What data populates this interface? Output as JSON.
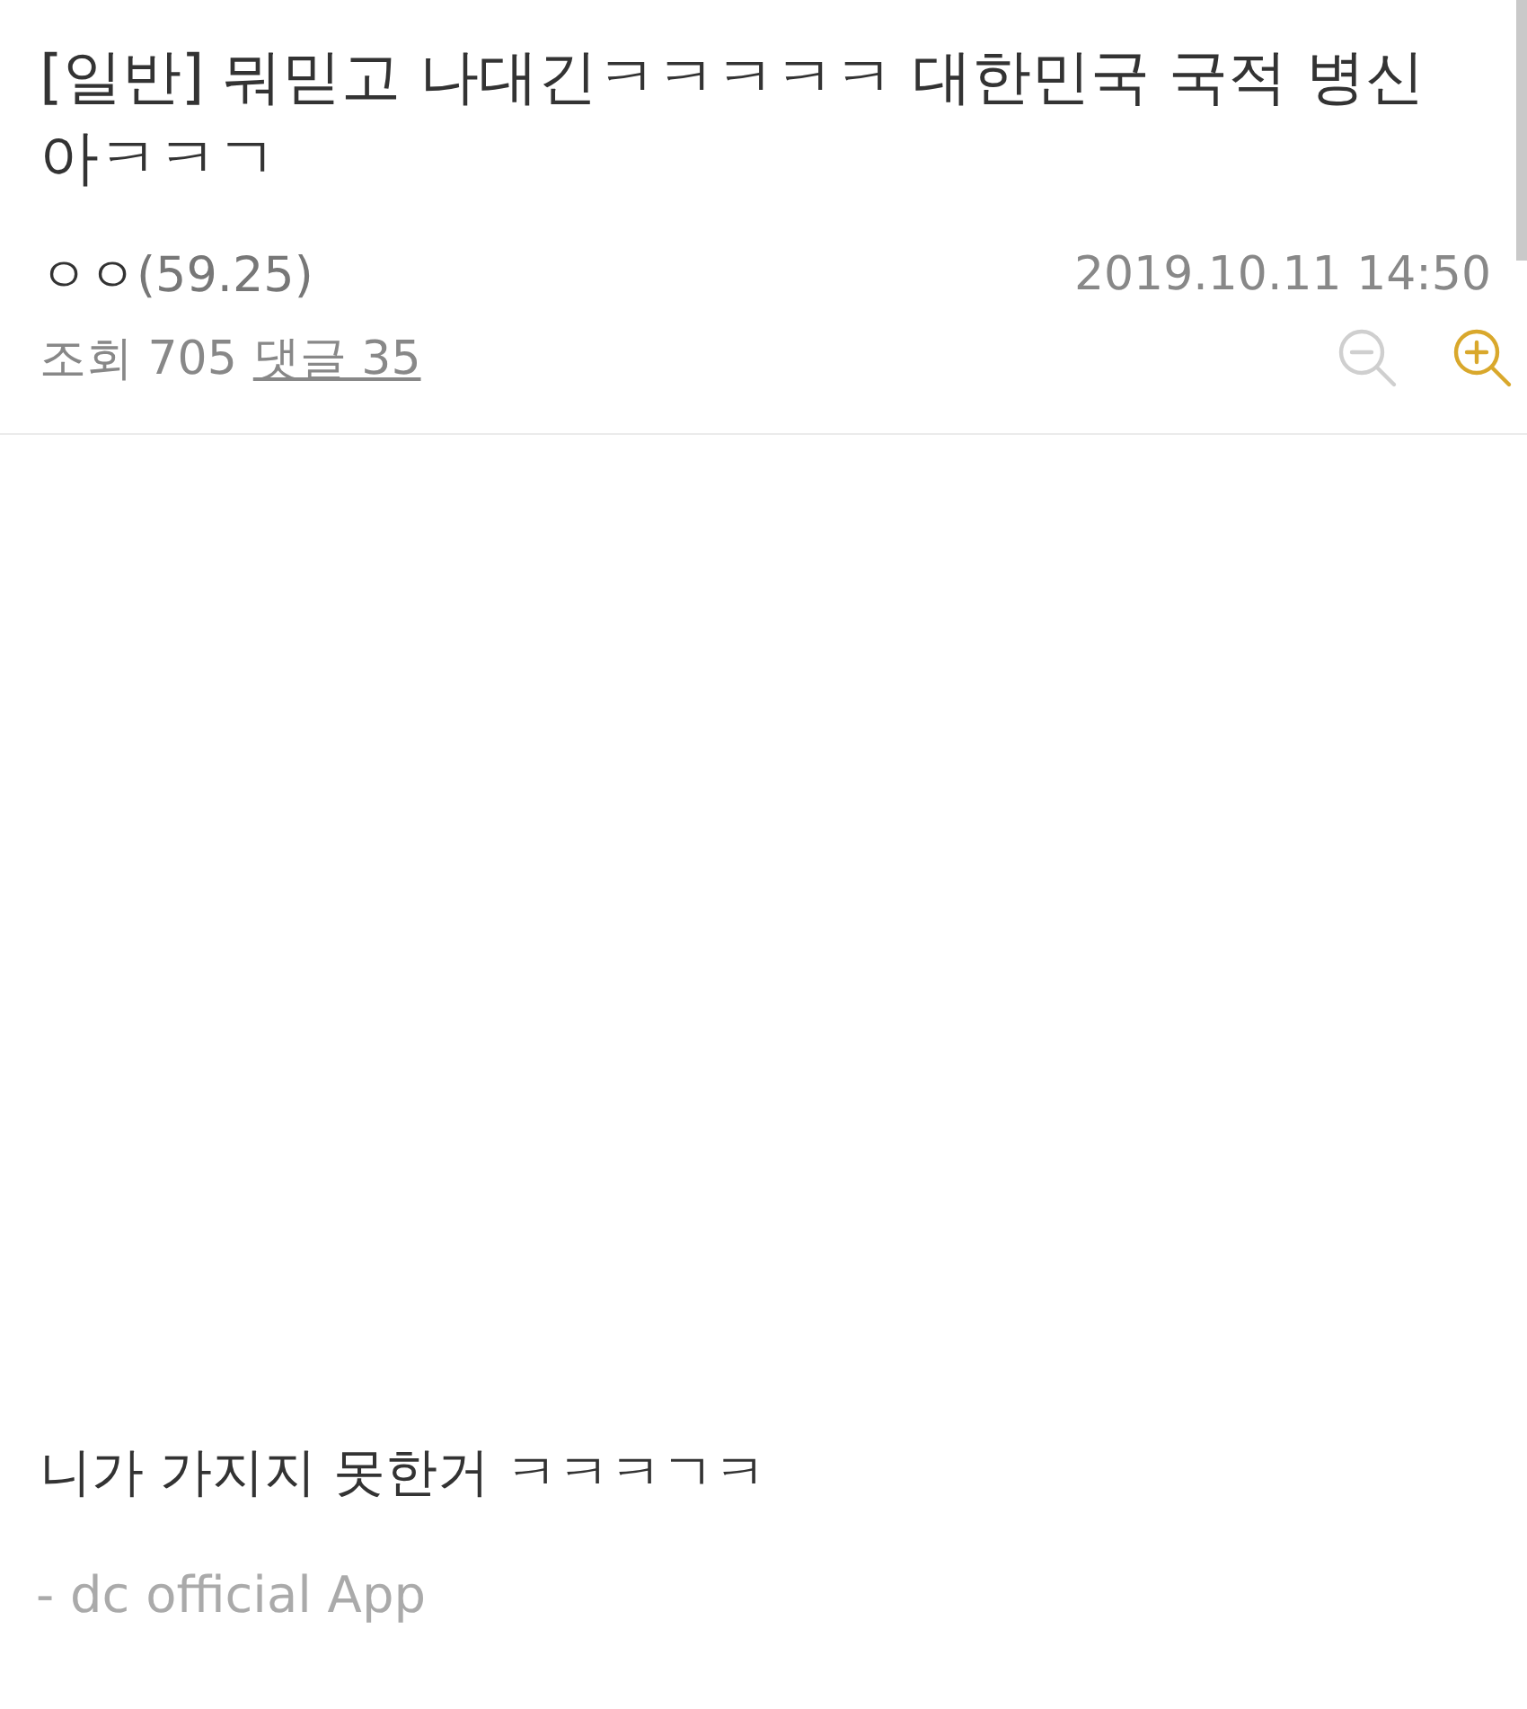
{
  "post": {
    "title": "[일반] 뭐믿고 나대긴ㅋㅋㅋㅋㅋ 대한민국 국적 병신아ㅋㅋㄱ",
    "author": {
      "nickname": "ㅇㅇ",
      "ip": "(59.25)"
    },
    "date": "2019.10.11 14:50",
    "views": "조회 705",
    "comments": "댓글 35",
    "zoom_out": {
      "disabled": true
    },
    "zoom_in": {
      "disabled": false
    }
  },
  "body": {
    "text": "니가 가지지 못한거 ㅋㅋㅋㄱㅋ",
    "signature": "- dc official App"
  }
}
